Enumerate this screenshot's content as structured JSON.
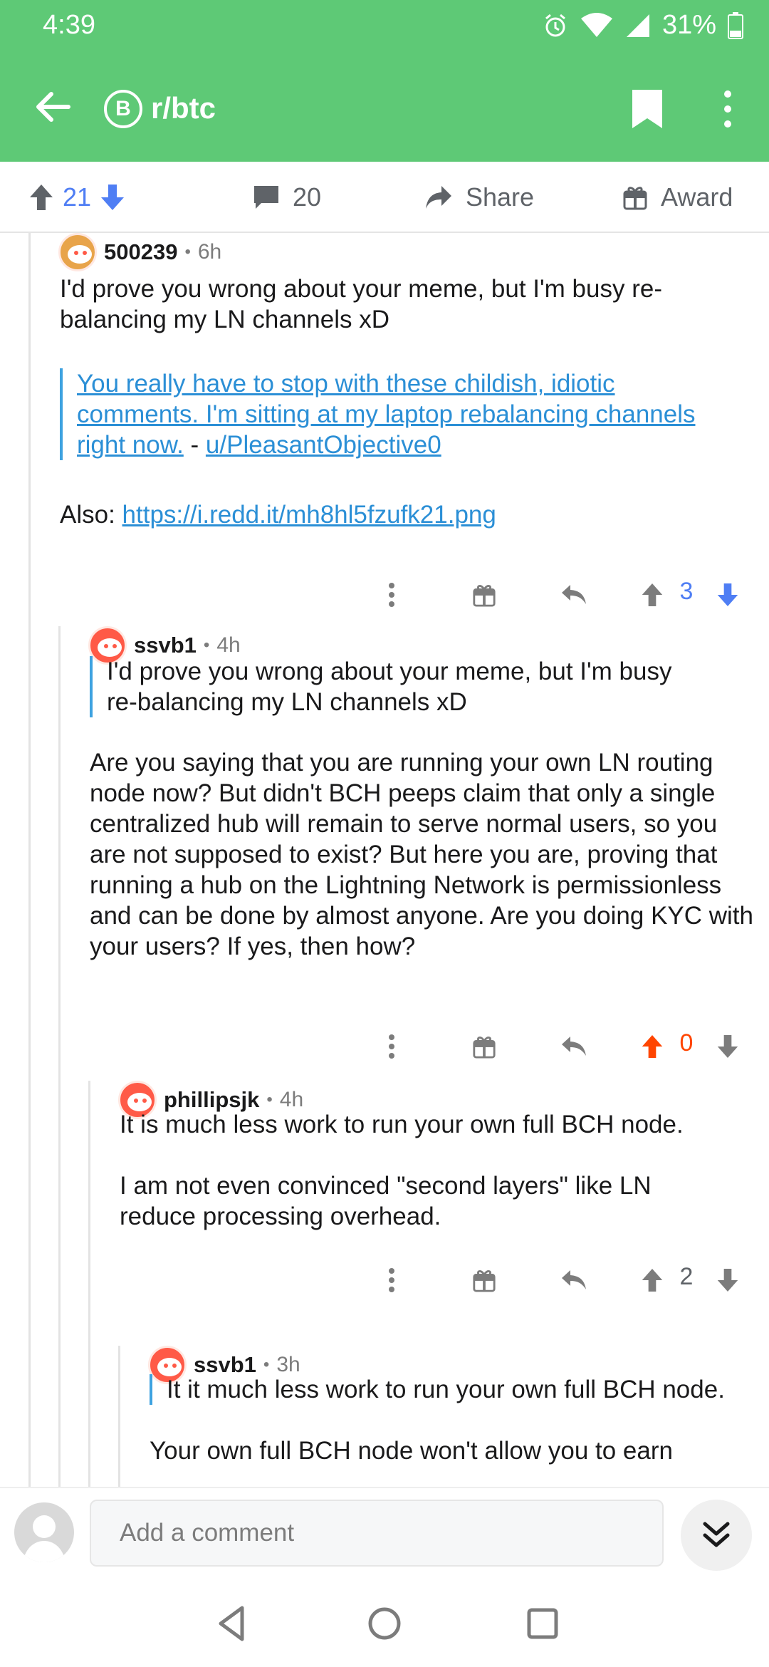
{
  "status": {
    "time": "4:39",
    "battery": "31%"
  },
  "header": {
    "subreddit": "r/btc",
    "subreddit_icon_letter": "B"
  },
  "post_actions": {
    "upvotes": "21",
    "comments": "20",
    "share_label": "Share",
    "award_label": "Award"
  },
  "comments": [
    {
      "author": "500239",
      "age": "6h",
      "body": "I'd prove you wrong about your meme, but I'm busy re-balancing my LN channels xD",
      "quote_line1": "You really have to stop with these childish, idiotic",
      "quote_line2": "comments. I'm sitting at my laptop rebalancing channels",
      "quote_line3a": "right now.",
      "quote_sep": " - ",
      "quote_user": "u/PleasantObjective0",
      "also_label": "Also: ",
      "also_link": "https://i.redd.it/mh8hl5fzufk21.png",
      "score": "3"
    },
    {
      "author": "ssvb1",
      "age": "4h",
      "quote": "I'd prove you wrong about your meme, but I'm busy re-balancing my LN channels xD",
      "body": "Are you saying that you are running your own LN routing node now? But didn't BCH peeps claim that only a single centralized hub will remain to serve normal users, so you are not supposed to exist? But here you are, proving that running a hub on the Lightning Network is permissionless and can be done by almost anyone. Are you doing KYC with your users? If yes, then how?",
      "score": "0"
    },
    {
      "author": "phillipsjk",
      "age": "4h",
      "body1": "It is much less work to run your own full BCH node.",
      "body2": "I am not even convinced \"second layers\" like LN reduce processing overhead.",
      "score": "2"
    },
    {
      "author": "ssvb1",
      "age": "3h",
      "quote": "It it much less work to run your own full BCH node.",
      "body": "Your own full BCH node won't allow you to earn"
    }
  ],
  "composer": {
    "placeholder": "Add a comment"
  },
  "colors": {
    "header": "#5ec976",
    "upvote": "#4f7ef4",
    "orangered": "#ff4500",
    "link": "#2b8fd6"
  }
}
